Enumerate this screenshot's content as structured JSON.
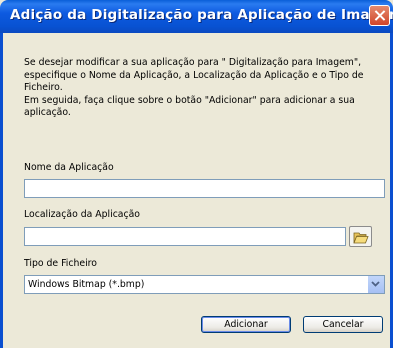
{
  "dialog": {
    "title": "Adição da Digitalização para Aplicação de Imagem",
    "instructions": {
      "line1": "Se desejar modificar a sua aplicação para \" Digitalização para Imagem\", especifique o Nome da Aplicação, a Localização da Aplicação e o Tipo de Ficheiro.",
      "line2": "Em seguida, faça clique sobre o botão  \"Adicionar\" para adicionar a sua aplicação."
    },
    "app_name": {
      "label": "Nome da Aplicação",
      "value": ""
    },
    "app_location": {
      "label": "Localização da Aplicação",
      "value": ""
    },
    "file_type": {
      "label": "Tipo de Ficheiro",
      "selected": "Windows Bitmap (*.bmp)"
    },
    "buttons": {
      "add": "Adicionar",
      "cancel": "Cancelar"
    }
  },
  "icons": {
    "close": "close-icon",
    "folder": "folder-open-icon",
    "dropdown": "chevron-down-icon"
  },
  "colors": {
    "titlebar": "#0a5fd8",
    "dialog_bg": "#ece9d8",
    "close": "#d0452a"
  }
}
